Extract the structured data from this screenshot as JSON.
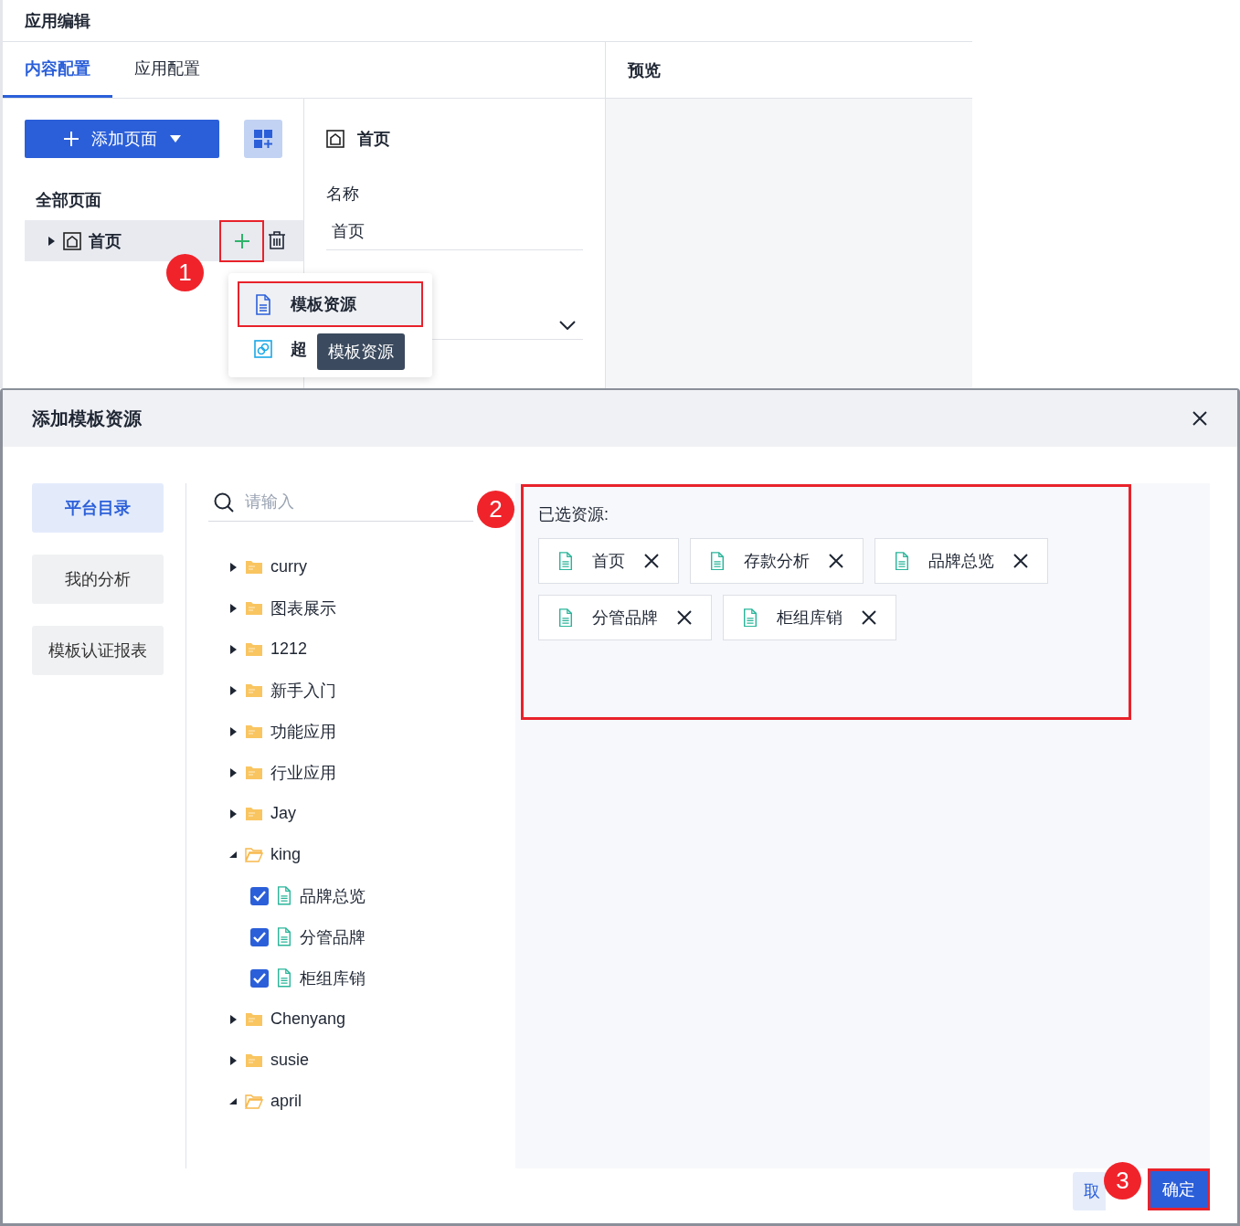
{
  "editor": {
    "title": "应用编辑",
    "tabs": [
      {
        "label": "内容配置",
        "selected": true
      },
      {
        "label": "应用配置",
        "selected": false
      }
    ],
    "add_page_button": "添加页面",
    "pages_heading": "全部页面",
    "pages": [
      {
        "label": "首页",
        "selected": true,
        "expanded": false
      }
    ],
    "callout": "1",
    "menu": [
      {
        "label": "模板资源",
        "kind": "template",
        "selected": true
      },
      {
        "label": "超",
        "kind": "link",
        "selected": false
      }
    ],
    "tooltip": "模板资源",
    "form": {
      "title": "首页",
      "name_label": "名称",
      "name_value": "首页"
    },
    "preview_title": "预览"
  },
  "dialog": {
    "title": "添加模板资源",
    "nav": [
      {
        "label": "平台目录",
        "selected": true
      },
      {
        "label": "我的分析",
        "selected": false
      },
      {
        "label": "模板认证报表",
        "selected": false
      }
    ],
    "search": {
      "placeholder": "请输入"
    },
    "tree": [
      {
        "label": "curry",
        "kind": "folder",
        "expanded": false
      },
      {
        "label": "图表展示",
        "kind": "folder",
        "expanded": false
      },
      {
        "label": "1212",
        "kind": "folder",
        "expanded": false
      },
      {
        "label": "新手入门",
        "kind": "folder",
        "expanded": false
      },
      {
        "label": "功能应用",
        "kind": "folder",
        "expanded": false
      },
      {
        "label": "行业应用",
        "kind": "folder",
        "expanded": false
      },
      {
        "label": "Jay",
        "kind": "folder",
        "expanded": false
      },
      {
        "label": "king",
        "kind": "folder",
        "expanded": true,
        "children": [
          {
            "label": "品牌总览",
            "kind": "file",
            "checked": true
          },
          {
            "label": "分管品牌",
            "kind": "file",
            "checked": true
          },
          {
            "label": "柜组库销",
            "kind": "file",
            "checked": true
          }
        ]
      },
      {
        "label": "Chenyang",
        "kind": "folder",
        "expanded": false
      },
      {
        "label": "susie",
        "kind": "folder",
        "expanded": false
      },
      {
        "label": "april",
        "kind": "folder",
        "expanded": true
      }
    ],
    "selected_label": "已选资源:",
    "callout": "2",
    "selected": [
      "首页",
      "存款分析",
      "品牌总览",
      "分管品牌",
      "柜组库销"
    ],
    "cancel_button": "取",
    "confirm_button": "确定",
    "footer_callout": "3"
  }
}
